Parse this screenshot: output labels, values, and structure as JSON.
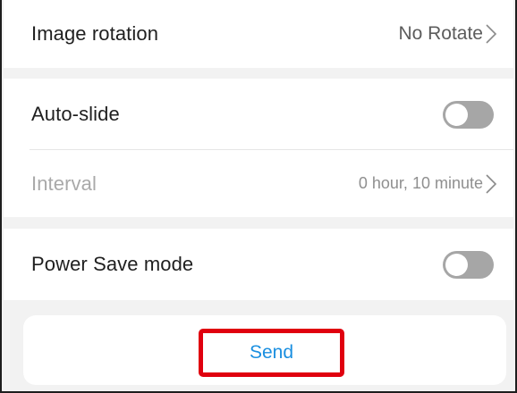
{
  "settings": {
    "image_rotation": {
      "label": "Image rotation",
      "value": "No Rotate"
    },
    "auto_slide": {
      "label": "Auto-slide",
      "enabled": false
    },
    "interval": {
      "label": "Interval",
      "value": "0 hour, 10 minute",
      "disabled": true
    },
    "power_save": {
      "label": "Power Save mode",
      "enabled": false
    }
  },
  "actions": {
    "send_label": "Send"
  },
  "colors": {
    "page_background": "#f2f2f2",
    "row_background": "#ffffff",
    "toggle_off": "#a6a6a6",
    "link_blue": "#1a8fe0",
    "highlight_red": "#e0000f"
  },
  "icons": {
    "row_chevron": "chevron-right-icon"
  }
}
